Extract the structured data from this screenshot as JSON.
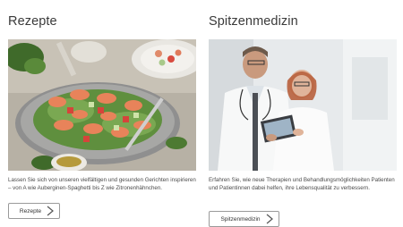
{
  "cards": [
    {
      "title": "Rezepte",
      "image_alt": "food-photo-salad-with-shrimp",
      "description": "Lassen Sie sich von unseren vielfältigen und gesunden Gerichten inspirieren – von A wie Auberginen-Spaghetti bis Z wie Zitronenhähnchen.",
      "button_label": "Rezepte",
      "button_icon": "chevron-right-icon"
    },
    {
      "title": "Spitzenmedizin",
      "image_alt": "photo-two-doctors-with-tablet",
      "description": "Erfahren Sie, wie neue Therapien und Behandlungsmöglichkeiten Patienten und Patientinnen dabei helfen, ihre Lebensqualität zu verbessern.",
      "button_label": "Spitzenmedizin",
      "button_icon": "chevron-right-icon"
    }
  ],
  "colors": {
    "text": "#333333",
    "border": "#9a9a9a",
    "background": "#ffffff"
  }
}
